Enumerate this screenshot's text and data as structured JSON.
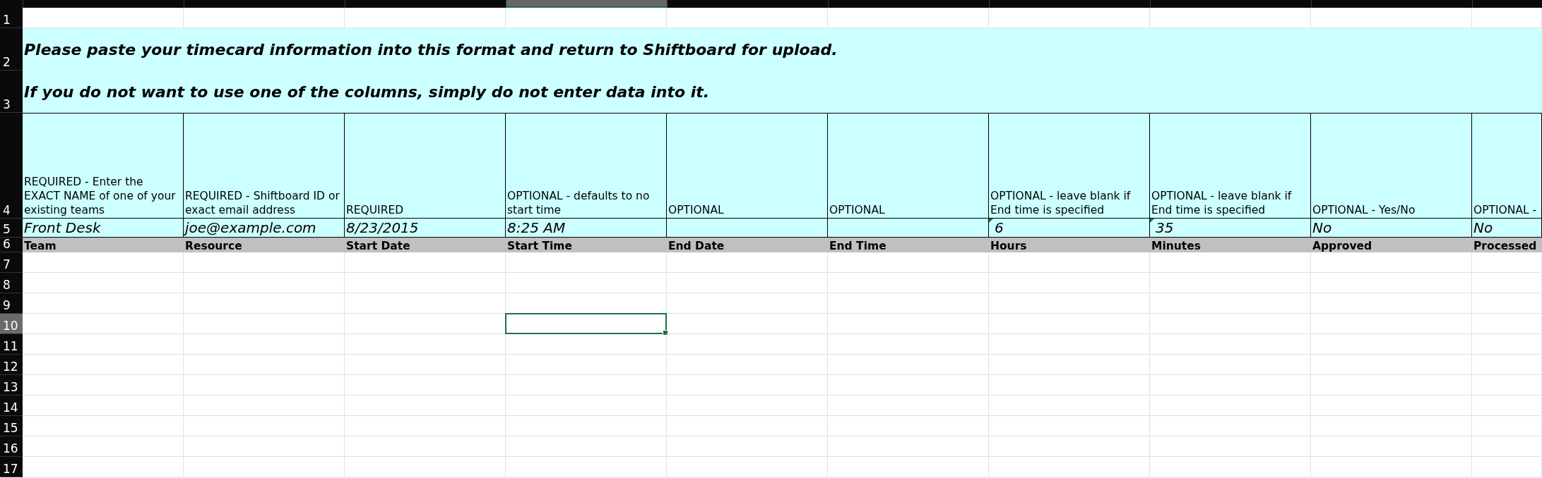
{
  "columns": [
    {
      "selected": false
    },
    {
      "selected": false
    },
    {
      "selected": false
    },
    {
      "selected": true
    },
    {
      "selected": false
    },
    {
      "selected": false
    },
    {
      "selected": false
    },
    {
      "selected": false
    },
    {
      "selected": false
    },
    {
      "selected": false
    }
  ],
  "top_row": {
    "number": "1"
  },
  "banner_rows": [
    {
      "number": "2",
      "text": "Please paste your timecard information into this format and return to Shiftboard for upload."
    },
    {
      "number": "3",
      "text": "If you do not want to use one of the columns, simply do not enter data into it."
    }
  ],
  "description_row": {
    "number": "4",
    "cells": [
      "REQUIRED - Enter the EXACT NAME of one of your existing teams",
      "REQUIRED - Shiftboard ID or exact email address",
      "REQUIRED",
      "OPTIONAL - defaults to no start time",
      "OPTIONAL",
      "OPTIONAL",
      "OPTIONAL - leave blank if End time is specified",
      "OPTIONAL - leave blank if End time is specified",
      "OPTIONAL - Yes/No",
      "OPTIONAL -"
    ]
  },
  "example_row": {
    "number": "5",
    "cells": [
      {
        "value": "Front Desk",
        "flag": false
      },
      {
        "value": "joe@example.com",
        "flag": false
      },
      {
        "value": "8/23/2015",
        "flag": false
      },
      {
        "value": "8:25 AM",
        "flag": false
      },
      {
        "flag": false
      },
      {
        "flag": false
      },
      {
        "value": "6",
        "flag": true
      },
      {
        "value": "35",
        "flag": true
      },
      {
        "value": "No",
        "flag": false
      },
      {
        "value": "No",
        "flag": false
      }
    ]
  },
  "header_row": {
    "number": "6",
    "cells": [
      "Team",
      "Resource",
      "Start Date",
      "Start Time",
      "End Date",
      "End Time",
      "Hours",
      "Minutes",
      "Approved",
      "Processed"
    ]
  },
  "empty_rows": [
    {
      "number": "7",
      "selected": false
    },
    {
      "number": "8",
      "selected": false
    },
    {
      "number": "9",
      "selected": false
    },
    {
      "number": "10",
      "selected": true
    },
    {
      "number": "11",
      "selected": false
    },
    {
      "number": "12",
      "selected": false
    },
    {
      "number": "13",
      "selected": false
    },
    {
      "number": "14",
      "selected": false
    },
    {
      "number": "15",
      "selected": false
    },
    {
      "number": "16",
      "selected": false
    },
    {
      "number": "17",
      "selected": false
    }
  ]
}
